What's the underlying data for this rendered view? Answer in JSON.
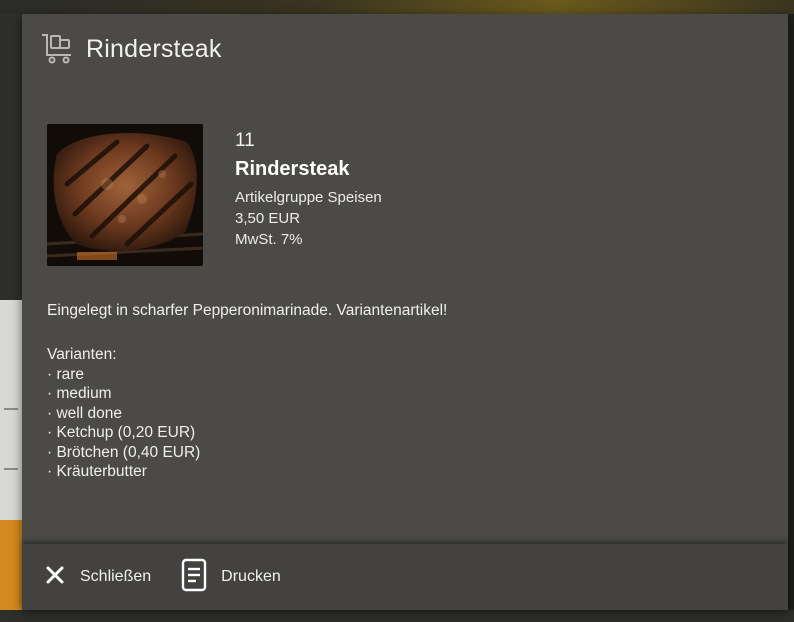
{
  "dialog": {
    "title": "Rindersteak",
    "header_icon": "cart-icon"
  },
  "product": {
    "image_alt": "grilled-steak-image",
    "number": "11",
    "name": "Rindersteak",
    "group": "Artikelgruppe Speisen",
    "price": "3,50 EUR",
    "tax": "MwSt. 7%"
  },
  "description": "Eingelegt in scharfer Pepperonimarinade. Variantenartikel!",
  "variants": {
    "heading": "Varianten:",
    "items": [
      "· rare",
      "· medium",
      "· well done",
      "· Ketchup (0,20 EUR)",
      "· Brötchen (0,40 EUR)",
      "· Kräuterbutter"
    ]
  },
  "footer": {
    "close_label": "Schließen",
    "close_icon": "close-icon",
    "print_label": "Drucken",
    "print_icon": "document-icon"
  },
  "colors": {
    "dialog_bg": "#4b4a47",
    "footer_bg": "#434240",
    "text": "#f0f0ee"
  }
}
